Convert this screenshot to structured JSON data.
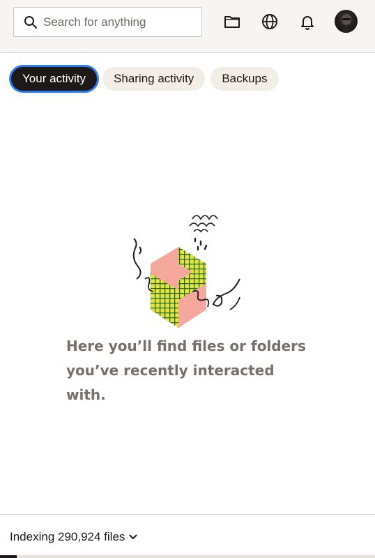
{
  "header": {
    "search": {
      "placeholder": "Search for anything",
      "value": ""
    },
    "icons": [
      "folder-icon",
      "globe-icon",
      "bell-icon"
    ],
    "avatar": "user-avatar"
  },
  "tabs": [
    {
      "label": "Your activity",
      "active": true
    },
    {
      "label": "Sharing activity",
      "active": false
    },
    {
      "label": "Backups",
      "active": false
    }
  ],
  "empty_state": {
    "message": "Here you’ll find files or folders you’ve recently interacted with."
  },
  "footer": {
    "status": "Indexing 290,924 files"
  },
  "colors": {
    "accent_focus": "#2f7cf6",
    "active_tab": "#1e1919",
    "tab_bg": "#f2ede6",
    "header_bg": "#f7f5f2",
    "message_text": "#776f6a"
  }
}
